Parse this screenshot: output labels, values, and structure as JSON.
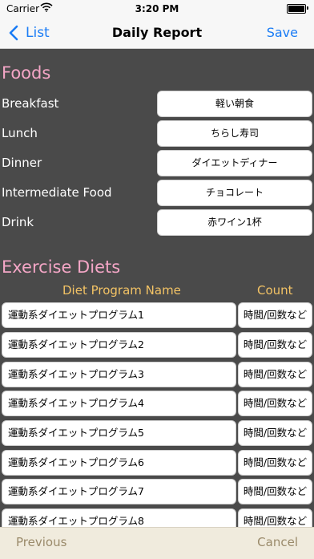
{
  "status_bar": {
    "carrier": "Carrier",
    "time": "3:20 PM"
  },
  "nav": {
    "back_label": "List",
    "title": "Daily Report",
    "save_label": "Save"
  },
  "foods": {
    "title": "Foods",
    "rows": [
      {
        "label": "Breakfast",
        "value": "軽い朝食"
      },
      {
        "label": "Lunch",
        "value": "ちらし寿司"
      },
      {
        "label": "Dinner",
        "value": "ダイエットディナー"
      },
      {
        "label": "Intermediate Food",
        "value": "チョコレート"
      },
      {
        "label": "Drink",
        "value": "赤ワイン1杯"
      }
    ]
  },
  "exercise": {
    "title": "Exercise Diets",
    "header_name": "Diet Program Name",
    "header_count": "Count",
    "rows": [
      {
        "name": "運動系ダイエットプログラム1",
        "count": "時間/回数など"
      },
      {
        "name": "運動系ダイエットプログラム2",
        "count": "時間/回数など"
      },
      {
        "name": "運動系ダイエットプログラム3",
        "count": "時間/回数など"
      },
      {
        "name": "運動系ダイエットプログラム4",
        "count": "時間/回数など"
      },
      {
        "name": "運動系ダイエットプログラム5",
        "count": "時間/回数など"
      },
      {
        "name": "運動系ダイエットプログラム6",
        "count": "時間/回数など"
      },
      {
        "name": "運動系ダイエットプログラム7",
        "count": "時間/回数など"
      },
      {
        "name": "運動系ダイエットプログラム8",
        "count": "時間/回数など"
      }
    ]
  },
  "toolbar": {
    "previous_label": "Previous",
    "cancel_label": "Cancel"
  },
  "colors": {
    "accent": "#1a7cf5",
    "section_title": "#f4a6c6",
    "column_header": "#f3c365",
    "content_background": "#4a4a4a",
    "toolbar_text": "#9a8a6a"
  },
  "icons": {
    "back": "chevron-left-icon",
    "wifi": "wifi-icon",
    "battery": "battery-icon"
  }
}
